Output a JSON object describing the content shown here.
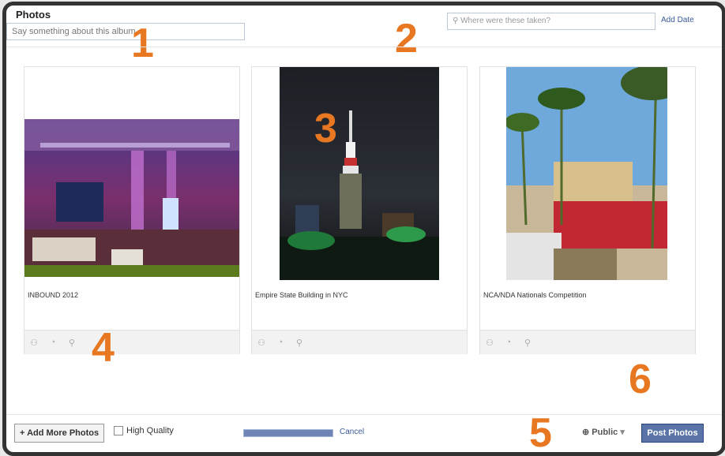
{
  "album": {
    "title": "Photos",
    "description_placeholder": "Say something about this album...",
    "location_placeholder": "Where were these taken?",
    "add_date_label": "Add Date"
  },
  "callouts": [
    "1",
    "2",
    "3",
    "4",
    "5",
    "6"
  ],
  "photos": [
    {
      "caption": "INBOUND 2012",
      "tag_icon": "person-tag-icon",
      "date_icon": "clock-icon",
      "place_icon": "location-pin-icon"
    },
    {
      "caption": "Empire State Building in NYC",
      "tag_icon": "person-tag-icon",
      "date_icon": "clock-icon",
      "place_icon": "location-pin-icon"
    },
    {
      "caption": "NCA/NDA Nationals Competition",
      "tag_icon": "person-tag-icon",
      "date_icon": "clock-icon",
      "place_icon": "location-pin-icon"
    }
  ],
  "footer": {
    "add_more_label": "+ Add More Photos",
    "high_quality_label": "High Quality",
    "upload_progress": 1.0,
    "cancel_label": "Cancel",
    "privacy_label": "Public",
    "post_label": "Post Photos"
  },
  "colors": {
    "callout": "#e87722",
    "brand_blue": "#5b74a8",
    "link": "#3b5998"
  }
}
